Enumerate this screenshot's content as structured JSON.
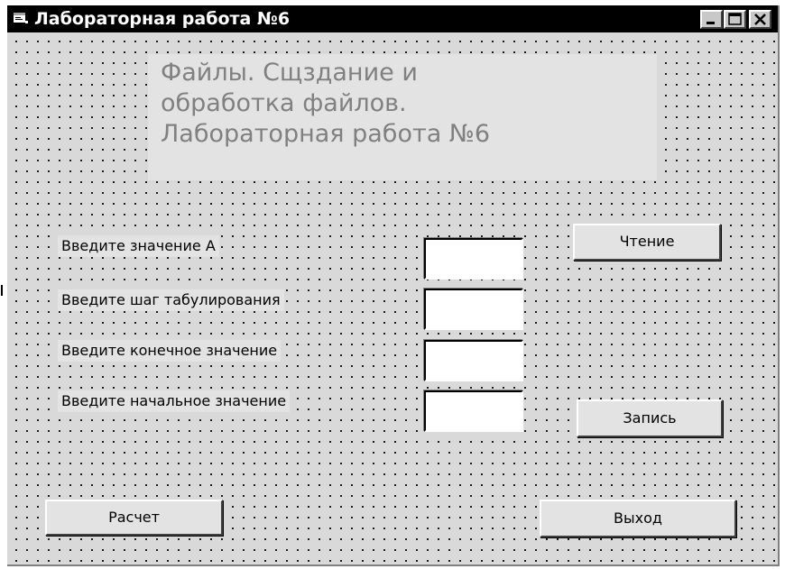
{
  "window": {
    "title": "Лабораторная работа №6",
    "icon": "form-icon",
    "controls": [
      "minimize-icon",
      "maximize-icon",
      "close-icon"
    ]
  },
  "heading": {
    "lines": [
      "Файлы. Сщздание и",
      "обработка файлов.",
      "Лабораторная работа №6"
    ]
  },
  "fields": [
    {
      "label": "Введите значение  А",
      "value": ""
    },
    {
      "label": "Введите шаг табулирования",
      "value": ""
    },
    {
      "label": "Введите конечное значение",
      "value": ""
    },
    {
      "label": "Введите начальное значение",
      "value": ""
    }
  ],
  "buttons": {
    "read": "Чтение",
    "write": "Запись",
    "calculate": "Расчет",
    "exit": "Выход"
  },
  "colors": {
    "titlebar": "#000000",
    "form_background": "#d9d9d9",
    "heading_text": "#808080"
  }
}
